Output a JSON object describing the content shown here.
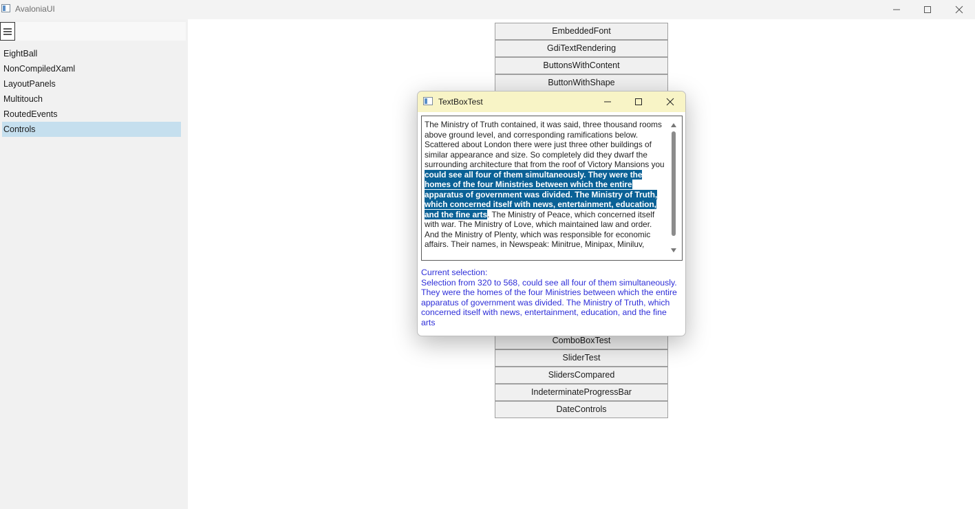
{
  "window": {
    "title": "AvaloniaUI"
  },
  "sidebar": {
    "items": [
      {
        "label": "EightBall",
        "selected": false
      },
      {
        "label": "NonCompiledXaml",
        "selected": false
      },
      {
        "label": "LayoutPanels",
        "selected": false
      },
      {
        "label": "Multitouch",
        "selected": false
      },
      {
        "label": "RoutedEvents",
        "selected": false
      },
      {
        "label": "Controls",
        "selected": true
      }
    ],
    "selected_color": "#c5dfee"
  },
  "controls": {
    "top_buttons": [
      "EmbeddedFont",
      "GdiTextRendering",
      "ButtonsWithContent",
      "ButtonWithShape"
    ],
    "bottom_buttons": [
      "ComboBoxTest",
      "SliderTest",
      "SlidersCompared",
      "IndeterminateProgressBar",
      "DateControls"
    ]
  },
  "dialog": {
    "title": "TextBoxTest",
    "textbox": {
      "before": "The Ministry of Truth contained, it was said, three thousand rooms above ground level, and corresponding ramifications below. Scattered about London there were just three other buildings of similar appearance and size. So completely did they dwarf the surrounding architecture that from the roof of Victory Mansions you ",
      "selected": "could see all four of them simultaneously. They were the homes of the four Ministries between which the entire apparatus of government was divided. The Ministry of Truth, which concerned itself with news, entertainment, education, and the fine arts",
      "after": ". The Ministry of Peace, which concerned itself with war. The Ministry of Love, which maintained law and order. And the Ministry of Plenty, which was responsible for economic affairs. Their names, in Newspeak: Minitrue, Minipax, Miniluv,",
      "selection_color": "#0a6196"
    },
    "selection_info": {
      "heading": "Current selection:",
      "text": "Selection from 320 to 568, could see all four of them simultaneously. They were the homes of the four Ministries between which the entire apparatus of government was divided. The Ministry of Truth, which concerned itself with news, entertainment, education, and the fine arts",
      "color": "#2d2dd8"
    },
    "titlebar_color": "#f8f4c6"
  }
}
